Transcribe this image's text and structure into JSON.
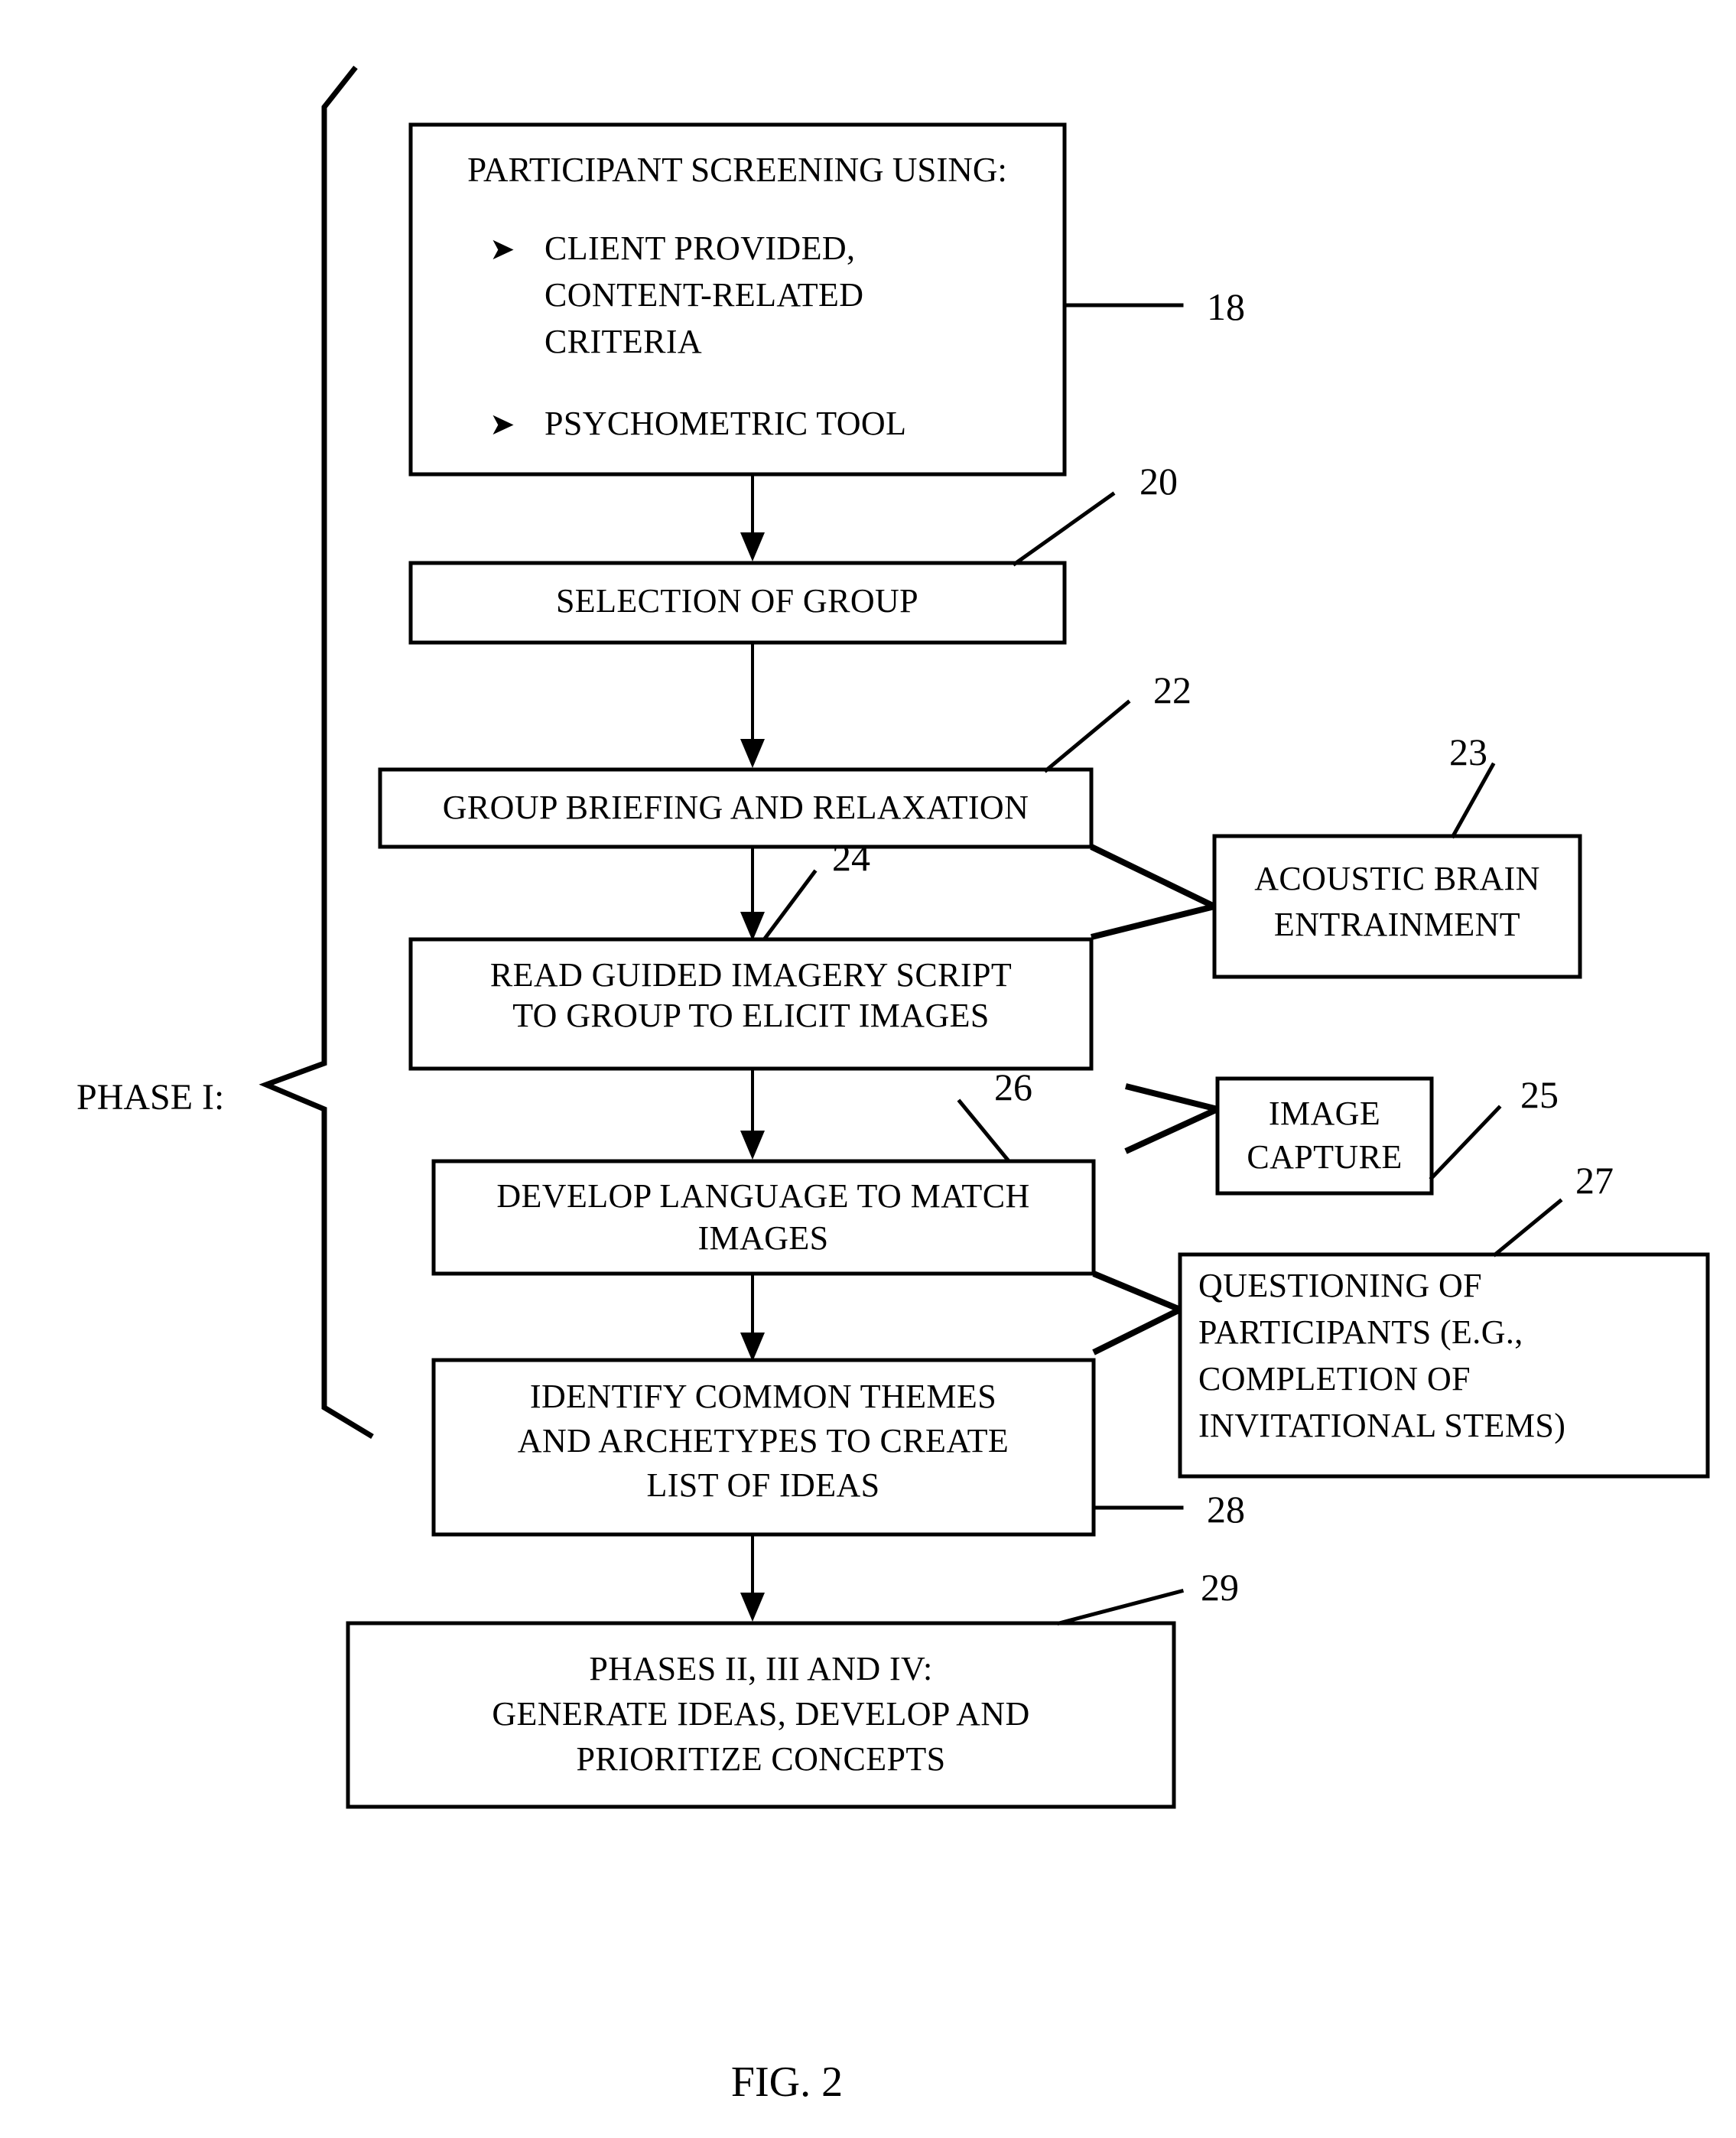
{
  "figure": {
    "caption": "FIG. 2",
    "phase_label": "PHASE I:"
  },
  "nodes": {
    "screening": {
      "ref": "18",
      "heading": "PARTICIPANT SCREENING USING:",
      "bullets": [
        [
          "CLIENT PROVIDED,",
          "CONTENT-RELATED",
          "CRITERIA"
        ],
        [
          "PSYCHOMETRIC TOOL"
        ]
      ],
      "bullet_glyph": "➤"
    },
    "selection": {
      "ref": "20",
      "lines": [
        "SELECTION OF GROUP"
      ]
    },
    "briefing": {
      "ref": "22",
      "lines": [
        "GROUP BRIEFING AND RELAXATION"
      ]
    },
    "read_script": {
      "ref": "24",
      "lines": [
        "READ GUIDED IMAGERY SCRIPT",
        "TO GROUP TO ELICIT IMAGES"
      ]
    },
    "develop_language": {
      "ref": "26",
      "lines": [
        "DEVELOP LANGUAGE TO MATCH",
        "IMAGES"
      ]
    },
    "identify_themes": {
      "ref": "28",
      "lines": [
        "IDENTIFY COMMON THEMES",
        "AND ARCHETYPES TO CREATE",
        "LIST OF IDEAS"
      ]
    },
    "later_phases": {
      "ref": "29",
      "lines": [
        "PHASES II, III AND IV:",
        "GENERATE IDEAS, DEVELOP AND",
        "PRIORITIZE CONCEPTS"
      ]
    },
    "acoustic": {
      "ref": "23",
      "lines": [
        "ACOUSTIC BRAIN",
        "ENTRAINMENT"
      ]
    },
    "image_capture": {
      "ref": "25",
      "lines": [
        "IMAGE",
        "CAPTURE"
      ]
    },
    "questioning": {
      "ref": "27",
      "lines": [
        "QUESTIONING OF",
        "PARTICIPANTS (E.G.,",
        "COMPLETION OF",
        "INVITATIONAL STEMS)"
      ]
    }
  },
  "colors": {
    "ink": "#000000",
    "paper": "#ffffff"
  }
}
